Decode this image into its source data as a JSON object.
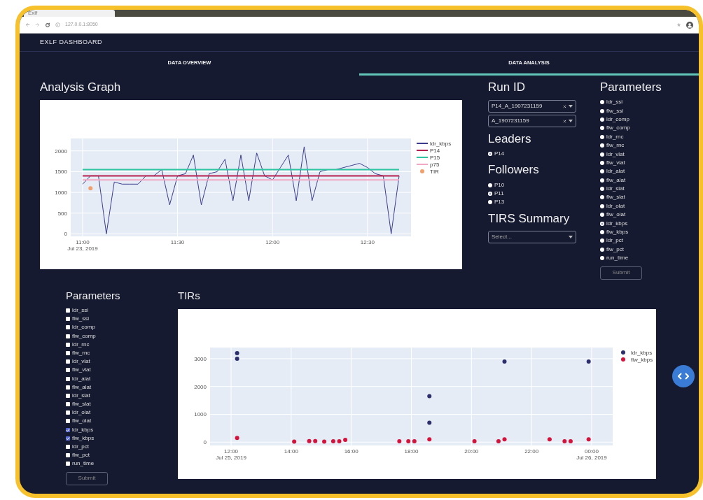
{
  "browser": {
    "tab_title": "Exlf",
    "url": "127.0.0.1:8050"
  },
  "navbar": {
    "title": "EXLF DASHBOARD"
  },
  "tabs": [
    {
      "label": "DATA OVERVIEW",
      "selected": false
    },
    {
      "label": "DATA ANALYSIS",
      "selected": true
    }
  ],
  "analysis_graph": {
    "title": "Analysis Graph",
    "chart_data": {
      "type": "line",
      "grid": true,
      "legend": "right",
      "ylim": [
        -60,
        2300
      ],
      "categories": [
        "11:00\nJul 23, 2019",
        null,
        null,
        null,
        null,
        null,
        null,
        null,
        null,
        null,
        null,
        null,
        "11:30",
        null,
        null,
        null,
        null,
        null,
        null,
        null,
        null,
        null,
        null,
        null,
        "12:00",
        null,
        null,
        null,
        null,
        null,
        null,
        null,
        null,
        null,
        null,
        null,
        "12:30",
        null,
        null,
        null,
        null
      ],
      "yticks": [
        0,
        500,
        1000,
        1500,
        2000
      ],
      "series": [
        {
          "name": "ldr_kbps",
          "color": "#3b3d8c",
          "values": [
            1200,
            1400,
            1400,
            0,
            1250,
            1200,
            1200,
            1200,
            1400,
            1400,
            1550,
            700,
            1400,
            1450,
            1900,
            700,
            1450,
            1500,
            1800,
            800,
            1900,
            800,
            1950,
            1400,
            1300,
            1600,
            1900,
            800,
            2100,
            800,
            1500,
            1550,
            1550,
            1600,
            1650,
            1700,
            1600,
            1450,
            1400,
            0,
            1400
          ]
        },
        {
          "name": "P14",
          "color": "#b8204f",
          "values": [
            1400,
            1400,
            1400,
            1400,
            1400,
            1400,
            1400,
            1400,
            1400,
            1400,
            1400,
            1400,
            1400,
            1400,
            1400,
            1400,
            1400,
            1400,
            1400,
            1400,
            1400,
            1400,
            1400,
            1400,
            1400,
            1400,
            1400,
            1400,
            1400,
            1400,
            1400,
            1400,
            1400,
            1400,
            1400,
            1400,
            1400,
            1400,
            1400,
            1400,
            1400
          ]
        },
        {
          "name": "P15",
          "color": "#2fc4a2",
          "values": [
            1550,
            1550,
            1550,
            1550,
            1550,
            1550,
            1550,
            1550,
            1550,
            1550,
            1550,
            1550,
            1550,
            1550,
            1550,
            1550,
            1550,
            1550,
            1550,
            1550,
            1550,
            1550,
            1550,
            1550,
            1550,
            1550,
            1550,
            1550,
            1550,
            1550,
            1550,
            1550,
            1550,
            1550,
            1550,
            1550,
            1550,
            1550,
            1550,
            1550,
            1550
          ]
        },
        {
          "name": "p75",
          "color": "#f2a7c3",
          "values": [
            1300,
            1300,
            1300,
            1300,
            1300,
            1300,
            1300,
            1300,
            1300,
            1300,
            1300,
            1300,
            1300,
            1300,
            1300,
            1300,
            1300,
            1300,
            1300,
            1300,
            1300,
            1300,
            1300,
            1300,
            1300,
            1300,
            1300,
            1300,
            1300,
            1300,
            1300,
            1300,
            1300,
            1300,
            1300,
            1300,
            1300,
            1300,
            1300,
            1300,
            1300
          ]
        },
        {
          "name": "TIR",
          "color": "#f0a070",
          "marker": true,
          "values": [
            null,
            1100,
            null,
            null,
            null,
            null,
            null,
            null,
            null,
            null,
            null,
            null,
            null,
            null,
            null,
            null,
            null,
            null,
            null,
            null,
            null,
            null,
            null,
            null,
            null,
            null,
            null,
            null,
            null,
            null,
            null,
            null,
            null,
            null,
            null,
            null,
            null,
            null,
            null,
            null,
            null
          ]
        }
      ]
    }
  },
  "run_id": {
    "title": "Run ID",
    "values": [
      {
        "label": "P14_A_1907231159"
      },
      {
        "label": "A_1907231159"
      }
    ]
  },
  "leaders": {
    "title": "Leaders",
    "options": [
      {
        "label": "P14",
        "selected": true
      }
    ]
  },
  "followers": {
    "title": "Followers",
    "options": [
      {
        "label": "P10",
        "selected": false
      },
      {
        "label": "P11",
        "selected": true
      },
      {
        "label": "P13",
        "selected": false
      }
    ]
  },
  "tirs_summary": {
    "title": "TIRS Summary",
    "placeholder": "Select..."
  },
  "parameters_radio": {
    "title": "Parameters",
    "button": "Submit",
    "options": [
      {
        "label": "ldr_ssi",
        "selected": false
      },
      {
        "label": "flw_ssi",
        "selected": false
      },
      {
        "label": "ldr_comp",
        "selected": false
      },
      {
        "label": "flw_comp",
        "selected": false
      },
      {
        "label": "ldr_rnc",
        "selected": false
      },
      {
        "label": "flw_rnc",
        "selected": false
      },
      {
        "label": "ldr_vlat",
        "selected": false
      },
      {
        "label": "flw_vlat",
        "selected": false
      },
      {
        "label": "ldr_alat",
        "selected": false
      },
      {
        "label": "flw_alat",
        "selected": false
      },
      {
        "label": "ldr_slat",
        "selected": false
      },
      {
        "label": "flw_slat",
        "selected": false
      },
      {
        "label": "ldr_olat",
        "selected": false
      },
      {
        "label": "flw_olat",
        "selected": false
      },
      {
        "label": "ldr_kbps",
        "selected": true
      },
      {
        "label": "flw_kbps",
        "selected": false
      },
      {
        "label": "ldr_pct",
        "selected": false
      },
      {
        "label": "flw_pct",
        "selected": false
      },
      {
        "label": "run_time",
        "selected": false
      }
    ]
  },
  "parameters_checklist": {
    "title": "Parameters",
    "button": "Submit",
    "options": [
      {
        "label": "ldr_ssi",
        "checked": false
      },
      {
        "label": "flw_ssi",
        "checked": false
      },
      {
        "label": "ldr_comp",
        "checked": false
      },
      {
        "label": "flw_comp",
        "checked": false
      },
      {
        "label": "ldr_rnc",
        "checked": false
      },
      {
        "label": "flw_rnc",
        "checked": false
      },
      {
        "label": "ldr_vlat",
        "checked": false
      },
      {
        "label": "flw_vlat",
        "checked": false
      },
      {
        "label": "ldr_alat",
        "checked": false
      },
      {
        "label": "flw_alat",
        "checked": false
      },
      {
        "label": "ldr_slat",
        "checked": false
      },
      {
        "label": "flw_slat",
        "checked": false
      },
      {
        "label": "ldr_olat",
        "checked": false
      },
      {
        "label": "flw_olat",
        "checked": false
      },
      {
        "label": "ldr_kbps",
        "checked": true
      },
      {
        "label": "flw_kbps",
        "checked": true
      },
      {
        "label": "ldr_pct",
        "checked": false
      },
      {
        "label": "flw_pct",
        "checked": false
      },
      {
        "label": "run_time",
        "checked": false
      }
    ]
  },
  "tirs": {
    "title": "TIRs",
    "chart_data": {
      "type": "scatter",
      "grid": true,
      "legend": "right",
      "xlim": [
        11.3,
        24.7
      ],
      "ylim": [
        -120,
        3400
      ],
      "x": [
        12.2,
        12.2,
        12.2,
        14.1,
        14.6,
        14.8,
        15.1,
        15.4,
        15.6,
        15.8,
        18.6,
        18.6,
        18.6,
        17.6,
        17.9,
        18.1,
        21.1,
        21.1,
        20.1,
        20.9,
        22.6,
        23.1,
        23.3,
        23.9,
        23.9
      ],
      "xticks": [
        {
          "value": 12,
          "label": "12:00\nJul 25, 2019"
        },
        {
          "value": 14,
          "label": "14:00"
        },
        {
          "value": 16,
          "label": "16:00"
        },
        {
          "value": 18,
          "label": "18:00"
        },
        {
          "value": 20,
          "label": "20:00"
        },
        {
          "value": 22,
          "label": "22:00"
        },
        {
          "value": 24,
          "label": "00:00\nJul 26, 2019"
        }
      ],
      "yticks": [
        0,
        1000,
        2000,
        3000
      ],
      "series": [
        {
          "name": "ldr_kbps",
          "color": "#2c2f6b",
          "values": [
            3200,
            3000,
            null,
            null,
            null,
            null,
            null,
            null,
            null,
            null,
            1650,
            700,
            null,
            null,
            null,
            null,
            2900,
            null,
            null,
            null,
            null,
            null,
            null,
            2900,
            null
          ]
        },
        {
          "name": "flw_kbps",
          "color": "#d3133b",
          "values": [
            null,
            null,
            150,
            20,
            40,
            40,
            20,
            30,
            30,
            80,
            null,
            null,
            100,
            30,
            30,
            30,
            null,
            100,
            30,
            30,
            100,
            30,
            30,
            null,
            100
          ]
        }
      ]
    }
  }
}
